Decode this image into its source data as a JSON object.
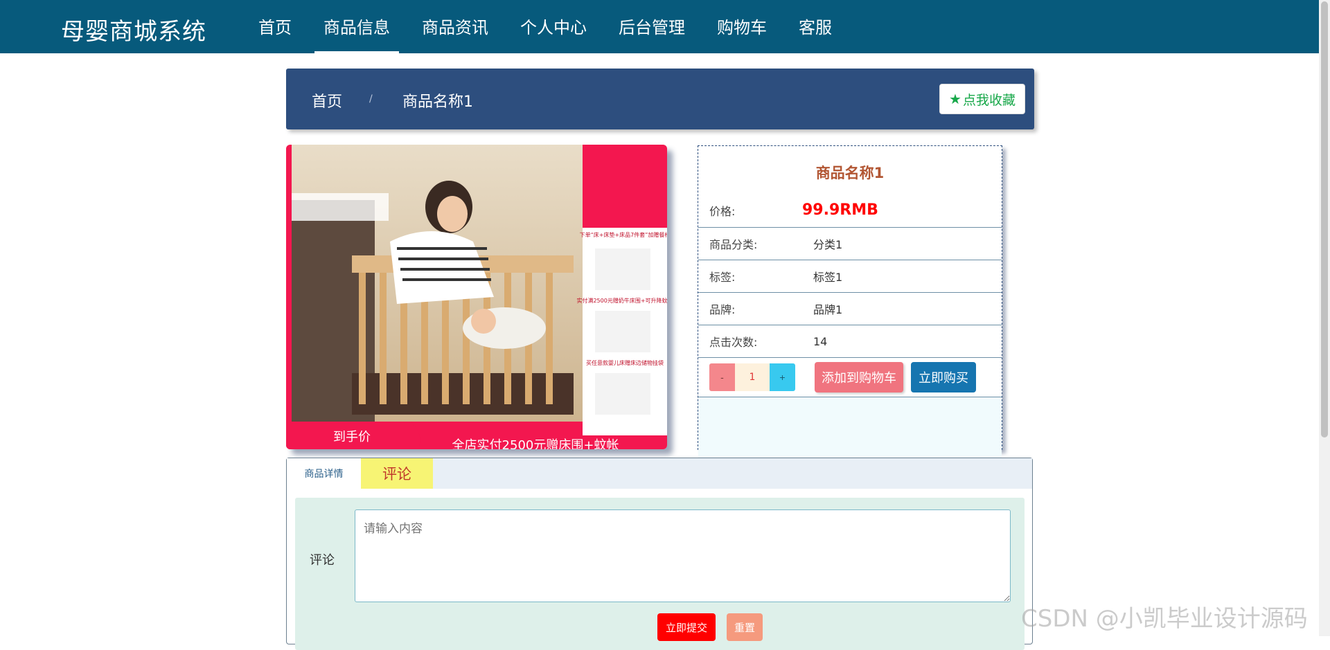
{
  "header": {
    "brand": "母婴商城系统",
    "nav": [
      "首页",
      "商品信息",
      "商品资讯",
      "个人中心",
      "后台管理",
      "购物车",
      "客服"
    ],
    "active_index": 1
  },
  "breadcrumb": {
    "home": "首页",
    "separator": "/",
    "current": "商品名称1",
    "favorite_label": "点我收藏"
  },
  "product_image": {
    "promo_texts": [
      "下单“床+床垫+床品7件套”加赠餐椅",
      "实付满2500元赠奶牛床围+可升降蚊帐",
      "买任意款婴儿床赠床边储物挂袋"
    ],
    "price_banner": "到手价",
    "bottom_banner": "全店实付2500元赠床围+蚊帐"
  },
  "product": {
    "title": "商品名称1",
    "price_label": "价格:",
    "price_value": "99.9RMB",
    "rows": [
      {
        "label": "商品分类:",
        "value": "分类1"
      },
      {
        "label": "标签:",
        "value": "标签1"
      },
      {
        "label": "品牌:",
        "value": "品牌1"
      },
      {
        "label": "点击次数:",
        "value": "14"
      }
    ],
    "quantity": "1",
    "minus": "-",
    "plus": "+",
    "add_to_cart": "添加到购物车",
    "buy_now": "立即购买"
  },
  "tabs": {
    "detail": "商品详情",
    "comment": "评论"
  },
  "comment_form": {
    "label": "评论",
    "placeholder": "请输入内容",
    "submit": "立即提交",
    "reset": "重置"
  },
  "watermark": "CSDN @小凯毕业设计源码",
  "colors": {
    "nav_bg": "#075a7c",
    "crumb_bg": "#2d4e7e",
    "price": "#ff0000",
    "cart_btn": "#f0747f",
    "buy_btn": "#1675b0"
  }
}
